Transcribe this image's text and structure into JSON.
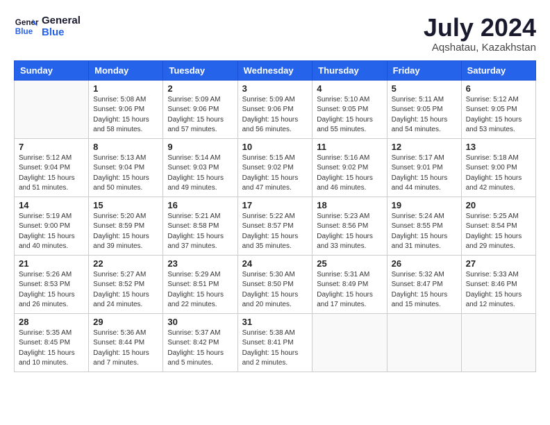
{
  "header": {
    "logo_line1": "General",
    "logo_line2": "Blue",
    "month": "July 2024",
    "location": "Aqshatau, Kazakhstan"
  },
  "days_of_week": [
    "Sunday",
    "Monday",
    "Tuesday",
    "Wednesday",
    "Thursday",
    "Friday",
    "Saturday"
  ],
  "weeks": [
    [
      {
        "day": "",
        "info": ""
      },
      {
        "day": "1",
        "info": "Sunrise: 5:08 AM\nSunset: 9:06 PM\nDaylight: 15 hours\nand 58 minutes."
      },
      {
        "day": "2",
        "info": "Sunrise: 5:09 AM\nSunset: 9:06 PM\nDaylight: 15 hours\nand 57 minutes."
      },
      {
        "day": "3",
        "info": "Sunrise: 5:09 AM\nSunset: 9:06 PM\nDaylight: 15 hours\nand 56 minutes."
      },
      {
        "day": "4",
        "info": "Sunrise: 5:10 AM\nSunset: 9:05 PM\nDaylight: 15 hours\nand 55 minutes."
      },
      {
        "day": "5",
        "info": "Sunrise: 5:11 AM\nSunset: 9:05 PM\nDaylight: 15 hours\nand 54 minutes."
      },
      {
        "day": "6",
        "info": "Sunrise: 5:12 AM\nSunset: 9:05 PM\nDaylight: 15 hours\nand 53 minutes."
      }
    ],
    [
      {
        "day": "7",
        "info": "Sunrise: 5:12 AM\nSunset: 9:04 PM\nDaylight: 15 hours\nand 51 minutes."
      },
      {
        "day": "8",
        "info": "Sunrise: 5:13 AM\nSunset: 9:04 PM\nDaylight: 15 hours\nand 50 minutes."
      },
      {
        "day": "9",
        "info": "Sunrise: 5:14 AM\nSunset: 9:03 PM\nDaylight: 15 hours\nand 49 minutes."
      },
      {
        "day": "10",
        "info": "Sunrise: 5:15 AM\nSunset: 9:02 PM\nDaylight: 15 hours\nand 47 minutes."
      },
      {
        "day": "11",
        "info": "Sunrise: 5:16 AM\nSunset: 9:02 PM\nDaylight: 15 hours\nand 46 minutes."
      },
      {
        "day": "12",
        "info": "Sunrise: 5:17 AM\nSunset: 9:01 PM\nDaylight: 15 hours\nand 44 minutes."
      },
      {
        "day": "13",
        "info": "Sunrise: 5:18 AM\nSunset: 9:00 PM\nDaylight: 15 hours\nand 42 minutes."
      }
    ],
    [
      {
        "day": "14",
        "info": "Sunrise: 5:19 AM\nSunset: 9:00 PM\nDaylight: 15 hours\nand 40 minutes."
      },
      {
        "day": "15",
        "info": "Sunrise: 5:20 AM\nSunset: 8:59 PM\nDaylight: 15 hours\nand 39 minutes."
      },
      {
        "day": "16",
        "info": "Sunrise: 5:21 AM\nSunset: 8:58 PM\nDaylight: 15 hours\nand 37 minutes."
      },
      {
        "day": "17",
        "info": "Sunrise: 5:22 AM\nSunset: 8:57 PM\nDaylight: 15 hours\nand 35 minutes."
      },
      {
        "day": "18",
        "info": "Sunrise: 5:23 AM\nSunset: 8:56 PM\nDaylight: 15 hours\nand 33 minutes."
      },
      {
        "day": "19",
        "info": "Sunrise: 5:24 AM\nSunset: 8:55 PM\nDaylight: 15 hours\nand 31 minutes."
      },
      {
        "day": "20",
        "info": "Sunrise: 5:25 AM\nSunset: 8:54 PM\nDaylight: 15 hours\nand 29 minutes."
      }
    ],
    [
      {
        "day": "21",
        "info": "Sunrise: 5:26 AM\nSunset: 8:53 PM\nDaylight: 15 hours\nand 26 minutes."
      },
      {
        "day": "22",
        "info": "Sunrise: 5:27 AM\nSunset: 8:52 PM\nDaylight: 15 hours\nand 24 minutes."
      },
      {
        "day": "23",
        "info": "Sunrise: 5:29 AM\nSunset: 8:51 PM\nDaylight: 15 hours\nand 22 minutes."
      },
      {
        "day": "24",
        "info": "Sunrise: 5:30 AM\nSunset: 8:50 PM\nDaylight: 15 hours\nand 20 minutes."
      },
      {
        "day": "25",
        "info": "Sunrise: 5:31 AM\nSunset: 8:49 PM\nDaylight: 15 hours\nand 17 minutes."
      },
      {
        "day": "26",
        "info": "Sunrise: 5:32 AM\nSunset: 8:47 PM\nDaylight: 15 hours\nand 15 minutes."
      },
      {
        "day": "27",
        "info": "Sunrise: 5:33 AM\nSunset: 8:46 PM\nDaylight: 15 hours\nand 12 minutes."
      }
    ],
    [
      {
        "day": "28",
        "info": "Sunrise: 5:35 AM\nSunset: 8:45 PM\nDaylight: 15 hours\nand 10 minutes."
      },
      {
        "day": "29",
        "info": "Sunrise: 5:36 AM\nSunset: 8:44 PM\nDaylight: 15 hours\nand 7 minutes."
      },
      {
        "day": "30",
        "info": "Sunrise: 5:37 AM\nSunset: 8:42 PM\nDaylight: 15 hours\nand 5 minutes."
      },
      {
        "day": "31",
        "info": "Sunrise: 5:38 AM\nSunset: 8:41 PM\nDaylight: 15 hours\nand 2 minutes."
      },
      {
        "day": "",
        "info": ""
      },
      {
        "day": "",
        "info": ""
      },
      {
        "day": "",
        "info": ""
      }
    ]
  ]
}
